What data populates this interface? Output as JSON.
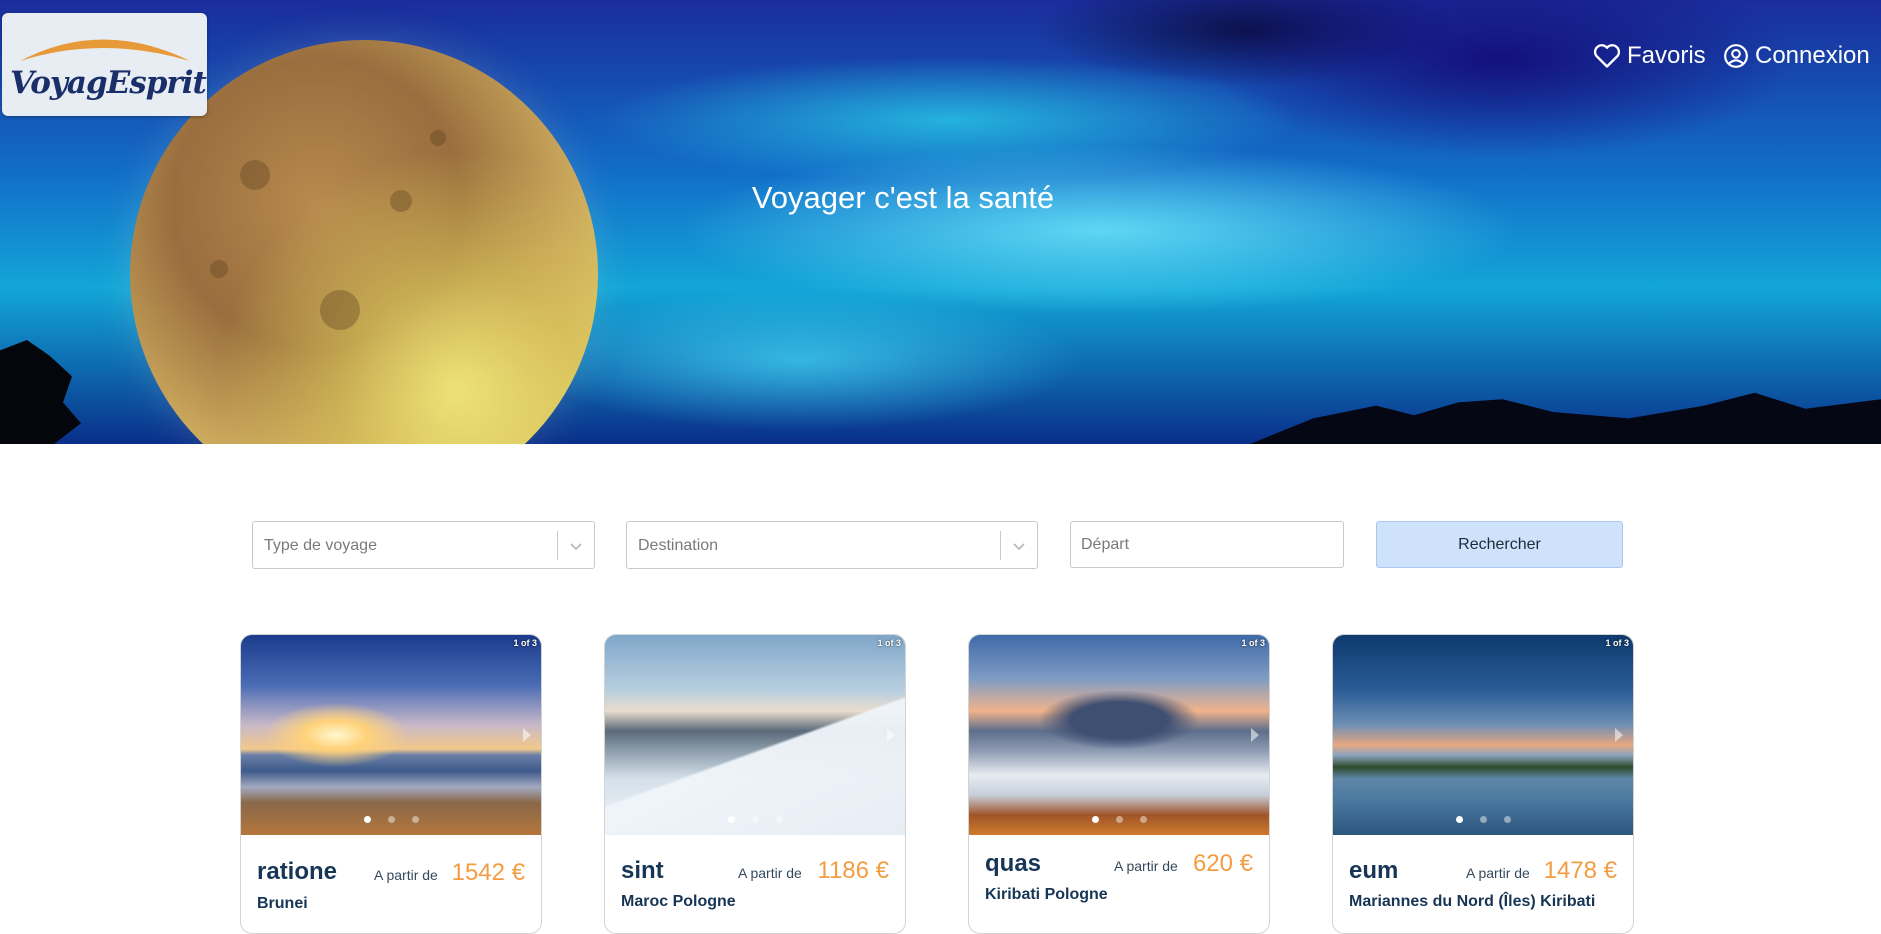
{
  "brand": {
    "logo_text": "VoyagEsprit"
  },
  "header": {
    "favorites_label": "Favoris",
    "favorites_icon": "heart-icon",
    "login_label": "Connexion",
    "login_icon": "user-circle-icon"
  },
  "hero": {
    "title": "Voyager c'est la santé"
  },
  "search": {
    "type_placeholder": "Type de voyage",
    "destination_placeholder": "Destination",
    "departure_placeholder": "Départ",
    "submit_label": "Rechercher"
  },
  "colors": {
    "price": "#f39d43",
    "title": "#173656",
    "button": "#cfe2fc"
  },
  "cards": [
    {
      "title": "ratione",
      "from_label": "A partir de",
      "price": "1542 €",
      "countries": "Brunei",
      "counter": "1 of 3",
      "slide": 1,
      "slides": 3
    },
    {
      "title": "sint",
      "from_label": "A partir de",
      "price": "1186 €",
      "countries": "Maroc Pologne",
      "counter": "1 of 3",
      "slide": 1,
      "slides": 3
    },
    {
      "title": "quas",
      "from_label": "A partir de",
      "price": "620 €",
      "countries": "Kiribati Pologne",
      "counter": "1 of 3",
      "slide": 1,
      "slides": 3
    },
    {
      "title": "eum",
      "from_label": "A partir de",
      "price": "1478 €",
      "countries": "Mariannes du Nord (Îles) Kiribati",
      "counter": "1 of 3",
      "slide": 1,
      "slides": 3
    }
  ]
}
